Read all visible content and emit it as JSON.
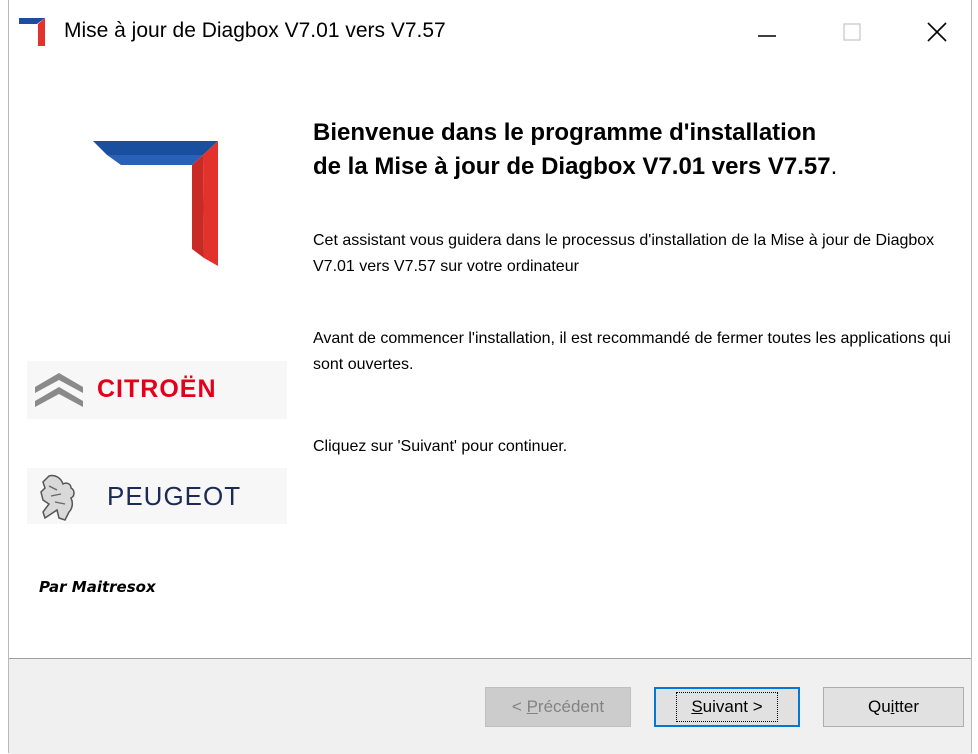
{
  "window": {
    "title": "Mise à jour de Diagbox V7.01 vers V7.57",
    "controls": [
      "minimize",
      "maximize",
      "close"
    ]
  },
  "left_panel": {
    "citroen_text": "CITROËN",
    "peugeot_text": "PEUGEOT",
    "credit": "Par Maitresox"
  },
  "main": {
    "heading_line1": "Bienvenue dans le programme d'installation",
    "heading_line2": "de la Mise à jour de Diagbox V7.01 vers V7.57",
    "heading_dot": ".",
    "paragraph1": "Cet assistant vous guidera dans le processus d'installation de la Mise à jour de Diagbox V7.01 vers V7.57 sur votre ordinateur",
    "paragraph2": "Avant de commencer l'installation, il est recommandé de fermer toutes les applications qui sont ouvertes.",
    "paragraph3": "Cliquez sur 'Suivant' pour continuer."
  },
  "footer": {
    "prev": {
      "prefix": "< ",
      "accel": "P",
      "rest": "récédent",
      "enabled": false
    },
    "next": {
      "accel": "S",
      "rest": "uivant >",
      "focused": true
    },
    "quit": {
      "prefix": "Qu",
      "accel": "i",
      "rest": "tter"
    }
  },
  "colors": {
    "logo_blue": "#1a4fa0",
    "logo_red": "#e3312b",
    "focus_border": "#0078d7",
    "citroen_red": "#e2001a"
  }
}
